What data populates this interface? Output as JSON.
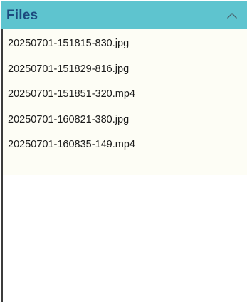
{
  "colors": {
    "header_bg": "#5ec4cf",
    "header_text": "#1c4a7e",
    "list_bg": "#fdfdf5",
    "empty_bg": "#ffffff"
  },
  "header": {
    "title": "Files",
    "collapse_icon": "chevron-up-icon"
  },
  "files": [
    "20250701-151815-830.jpg",
    "20250701-151829-816.jpg",
    "20250701-151851-320.mp4",
    "20250701-160821-380.jpg",
    "20250701-160835-149.mp4"
  ]
}
